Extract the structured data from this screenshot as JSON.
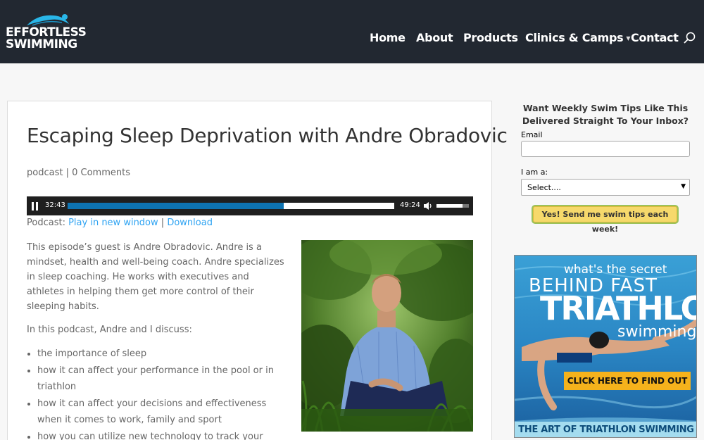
{
  "brand": {
    "line1": "EFFORTLESS",
    "line2": "SWIMMING"
  },
  "nav": {
    "home": "Home",
    "about": "About",
    "products": "Products",
    "clinics": "Clinics & Camps",
    "contact": "Contact"
  },
  "post": {
    "title": "Escaping Sleep Deprivation with Andre Obradovic",
    "category": "podcast",
    "separator": "|",
    "comments": "0 Comments",
    "player": {
      "current_time": "32:43",
      "duration": "49:24",
      "progress": 0.662,
      "volume": 0.8
    },
    "podcast_label": "Podcast:",
    "play_new_window": "Play in new window",
    "link_separator": "|",
    "download": "Download",
    "intro": "This episode’s guest is Andre Obradovic. Andre is a mindset, health and well-being coach. Andre specializes in sleep coaching. He works with executives and athletes in helping them get more control of their sleeping habits.",
    "discuss": "In this podcast, Andre and I discuss:",
    "bullets": [
      "the importance of sleep",
      "how it can affect your performance in the pool or in triathlon",
      "how it can affect your decisions and effectiveness when it comes to work, family and sport",
      "how you can utilize new technology to track your sleep and performance"
    ]
  },
  "sidebar": {
    "title": "Want Weekly Swim Tips Like This Delivered Straight To Your Inbox?",
    "email_label": "Email",
    "email_value": "",
    "iam_label": "I am a:",
    "select_value": "Select....",
    "submit": "Yes! Send me swim tips each week!"
  },
  "ad": {
    "line1": "what's the secret",
    "line2": "BEHIND FAST",
    "line3": "TRIATHLON",
    "line4": "swimming?",
    "cta": "CLICK HERE TO FIND OUT",
    "footer": "THE ART OF TRIATHLON SWIMMING"
  },
  "colors": {
    "header_bg": "#222831",
    "link": "#2ea3f2",
    "progress": "#0e73b1",
    "button": "#f6d96b"
  }
}
